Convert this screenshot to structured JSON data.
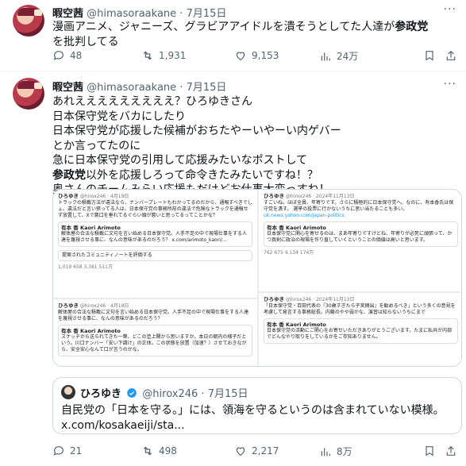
{
  "tweet1": {
    "display_name": "暇空茜",
    "handle": "@himasoraakane",
    "dot": "·",
    "date": "7月15日",
    "text_pre": "漫画アニメ、ジャニーズ、グラビアアイドルを潰そうとしてた人達が",
    "text_bold": "参政党",
    "text_post": "を批判してる",
    "replies": "48",
    "retweets": "1,931",
    "likes": "9,153",
    "views": "24万"
  },
  "tweet2": {
    "display_name": "暇空茜",
    "handle": "@himasoraakane",
    "dot": "·",
    "date": "7月15日",
    "line1": "あれえええええええええ？ひろゆきさん",
    "line2": "日本保守党をバカにしたり",
    "line3": "日本保守党が応援した候補がおちたやーいやーい内ゲバー",
    "line4": "とか言ってたのに",
    "line5": "急に日本保守党の引用して応援みたいなポストして",
    "line6_bold": "参政党",
    "line6_rest": "以外を応援しろって命令きたみたいですね！？",
    "line7": "奥さんのチームみらい応援もだけどお仕事大変っすね！",
    "replies": "21",
    "retweets": "498",
    "likes": "2,217",
    "views": "8万"
  },
  "grid": {
    "p1": {
      "name": "ひろゆき",
      "meta": "@hirox246 · 4月19日",
      "text": "トラックの積載方法が違法なら、ナンバープレートもわかってるのだから、通報すべきでしょ。違法だと言い張ってる人は、日本保守党の事務所前の違法で危険なトラックを通報せず放置して、Xで悪口を垂れてるぐらい頭が悪いと思ってるってことかな？",
      "q_name": "有本 香 Kaori Arimoto",
      "q_text": "解体屋の合法な積載に文句を言い始める日本保守党。人手不足の中で現場仕事をする人達を蔑視させる事に、なんの意味があるのだろう？ x.com/arimoto_kaori/...",
      "note_btn": "提案されたコミュニティノートを評価する",
      "stats": "1,019   658   3,381   511万"
    },
    "p2": {
      "name": "ひろゆき",
      "meta": "@hirox246 · 2024年11月13日",
      "text": "すごいね。ほぼ全員、年寄りです。さらに積極的に日本保守党へ。なのに、有本香氏は保守党を潰す。 選挙の投票に行かないうちに思い当たることも多い。",
      "link": "uk.news.yahoo.com/japan-politics",
      "q_name": "有本 香 Kaori Arimoto",
      "q_text": "日本保守党に関心を寄せるのは、まあ年寄りですけどね、年寄りが必死に頑張って、かつ真剣に政治の現場を作り直していくということの価値は高いと思います。",
      "stats": "762   675   4,134   174万"
    },
    "p3": {
      "name": "ひろゆき",
      "meta": "@hirox246 · 4月18日",
      "text": "解体屋の合法な積載に文句を言い始める日本保守党。人手不足の中で現場仕事をする人達を蔑視させる事に、なんの意味があるのだろう？",
      "q_name": "有本 香 Kaori Arimoto",
      "q_text": "スケッチから送られてきた一葉、どこの塗上関から思いますか。本日の朝内の様子だという。川口ナンバー「安い下請け」の正体。この状態を放置（加速？）させておきながら、安全安心なんて口が言うのかな。"
    },
    "p4": {
      "name": "ひろゆき",
      "meta": "@hirox246 · 2024年11月13日",
      "text": "「日本保守党・百田代表の『30歳すぎたら子宮摘出』を勧めるべき」という多くの意見を考慮して発言する事務総長。内藤のやや弱かな、演習は知らないうちにまで",
      "q_name": "有本 香 Kaori Arimoto",
      "q_text": "日本保守党の活動にご関心をお寄せいただきありがとうございます。たまに私共が内部でどんなやり取りをしているかをご存知ありません。"
    }
  },
  "quote": {
    "display_name": "ひろゆき",
    "handle": "@hirox246",
    "dot": "·",
    "date": "7月15日",
    "text": "自民党の「日本を守る。」には、領海を守るというのは含まれていない模様。",
    "link": "x.com/kosakaeiji/sta..."
  },
  "icons": [
    "more-icon",
    "reply-icon",
    "retweet-icon",
    "like-icon",
    "views-icon",
    "bookmark-icon",
    "share-icon",
    "verified-icon"
  ],
  "colors": {
    "text": "#0f1419",
    "muted": "#536471",
    "border": "#cfd9de",
    "verified": "#1d9bf0"
  }
}
